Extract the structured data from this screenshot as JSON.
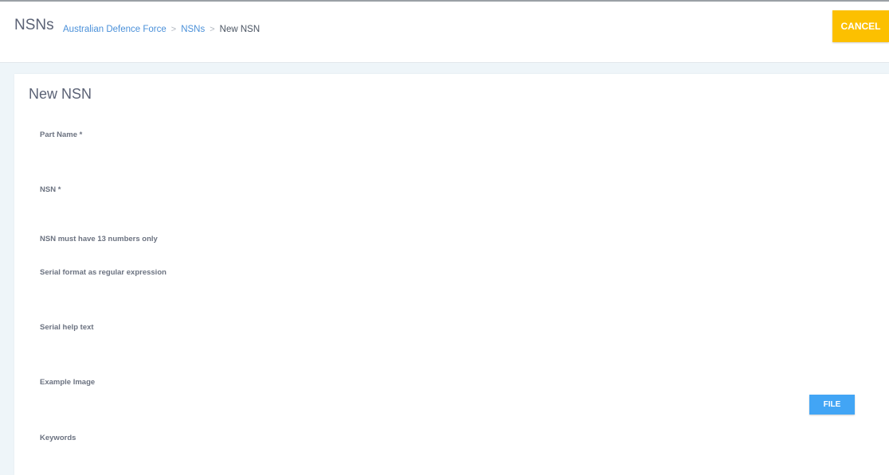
{
  "header": {
    "title": "NSNs",
    "breadcrumb": {
      "items": [
        "Australian Defence Force",
        "NSNs"
      ],
      "separator": ">",
      "current": "New NSN"
    },
    "cancel_label": "CANCEL"
  },
  "form": {
    "title": "New NSN",
    "part_name": {
      "label": "Part Name *",
      "value": ""
    },
    "nsn": {
      "label": "NSN *",
      "value": "",
      "hint": "NSN must have 13 numbers only"
    },
    "serial_format": {
      "label": "Serial format as regular expression",
      "value": ""
    },
    "serial_help": {
      "label": "Serial help text",
      "value": ""
    },
    "example_image": {
      "label": "Example Image",
      "file_label": "FILE"
    },
    "keywords": {
      "label": "Keywords",
      "value": ""
    }
  },
  "colors": {
    "cancel": "#fcc000",
    "file": "#42a5f5",
    "link": "#4a90d9"
  }
}
